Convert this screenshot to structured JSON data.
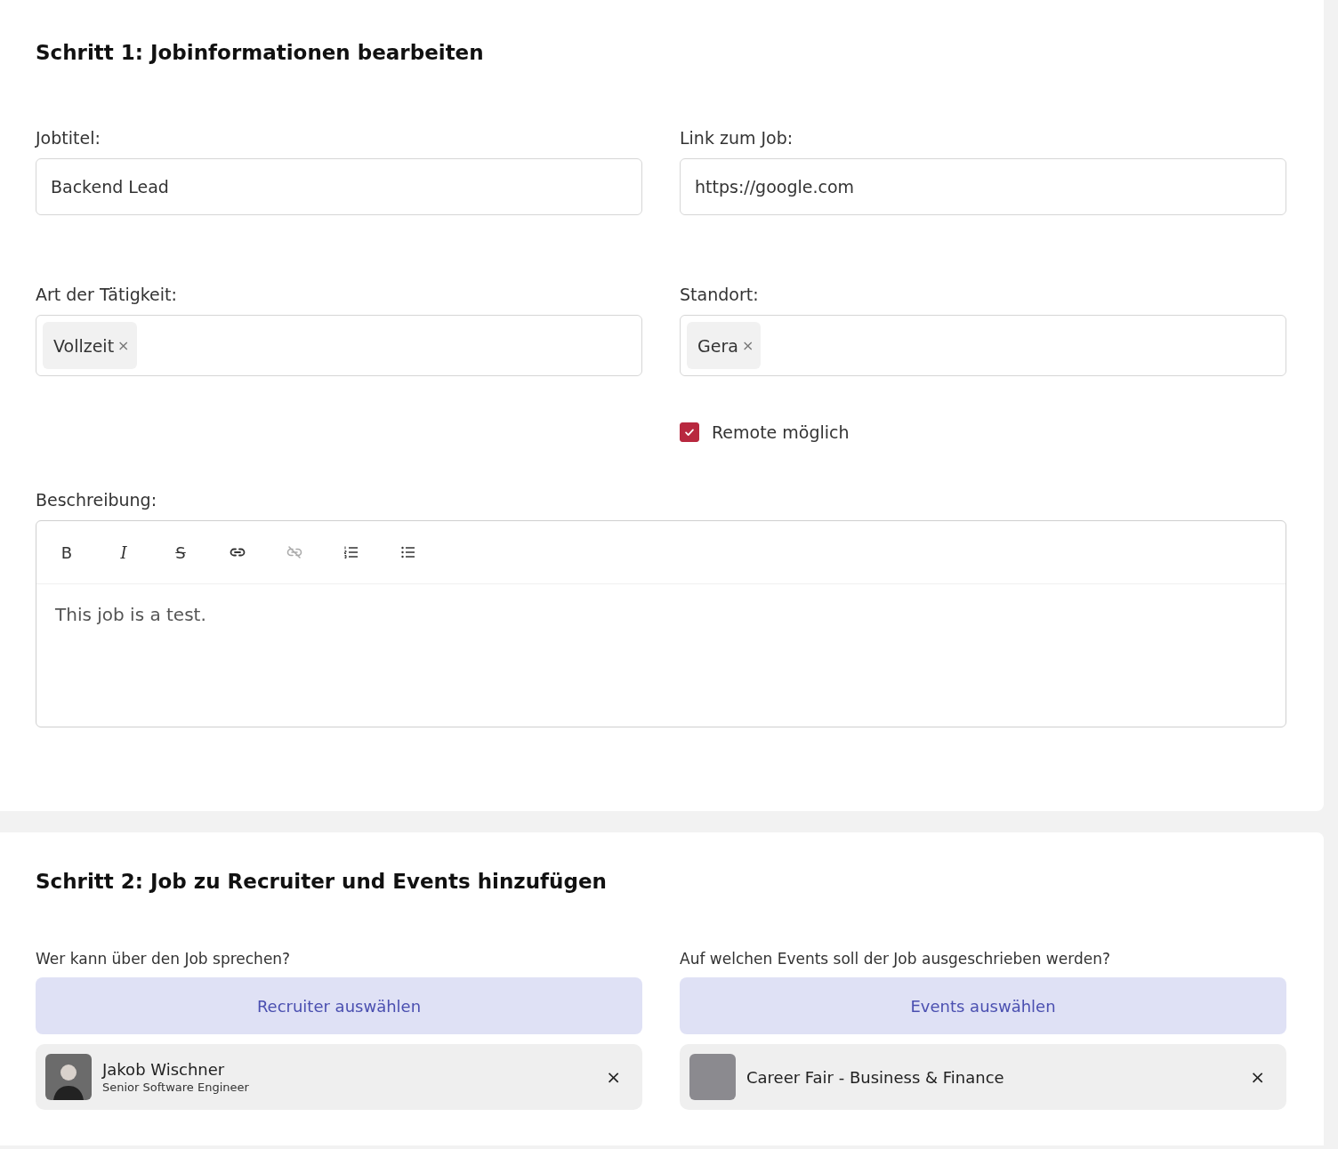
{
  "step1": {
    "title": "Schritt 1: Jobinformationen bearbeiten",
    "job_title": {
      "label": "Jobtitel:",
      "value": "Backend Lead"
    },
    "job_link": {
      "label": "Link zum Job:",
      "value": "https://google.com"
    },
    "job_type": {
      "label": "Art der Tätigkeit:",
      "tags": [
        {
          "text": "Vollzeit",
          "remove": "×"
        }
      ]
    },
    "location": {
      "label": "Standort:",
      "tags": [
        {
          "text": "Gera",
          "remove": "×"
        }
      ]
    },
    "remote": {
      "label": "Remote möglich",
      "checked": true
    },
    "description": {
      "label": "Beschreibung:",
      "toolbar": [
        {
          "kind": "bold",
          "text": "B",
          "disabled": false
        },
        {
          "kind": "italic",
          "text": "I",
          "disabled": false
        },
        {
          "kind": "strike",
          "text": "S",
          "disabled": false
        },
        {
          "kind": "link",
          "disabled": false
        },
        {
          "kind": "unlink",
          "disabled": true
        },
        {
          "kind": "ordered-list",
          "disabled": false
        },
        {
          "kind": "bullet-list",
          "disabled": false
        }
      ],
      "value": "This job is a test."
    }
  },
  "step2": {
    "title": "Schritt 2: Job zu Recruiter und Events hinzufügen",
    "recruiters": {
      "question": "Wer kann über den Job sprechen?",
      "button": "Recruiter auswählen",
      "items": [
        {
          "name": "Jakob Wischner",
          "role": "Senior Software Engineer",
          "remove": "×"
        }
      ]
    },
    "events": {
      "question": "Auf welchen Events soll der Job ausgeschrieben werden?",
      "button": "Events auswählen",
      "items": [
        {
          "name": "Career Fair - Business & Finance",
          "remove": "×"
        }
      ]
    }
  }
}
